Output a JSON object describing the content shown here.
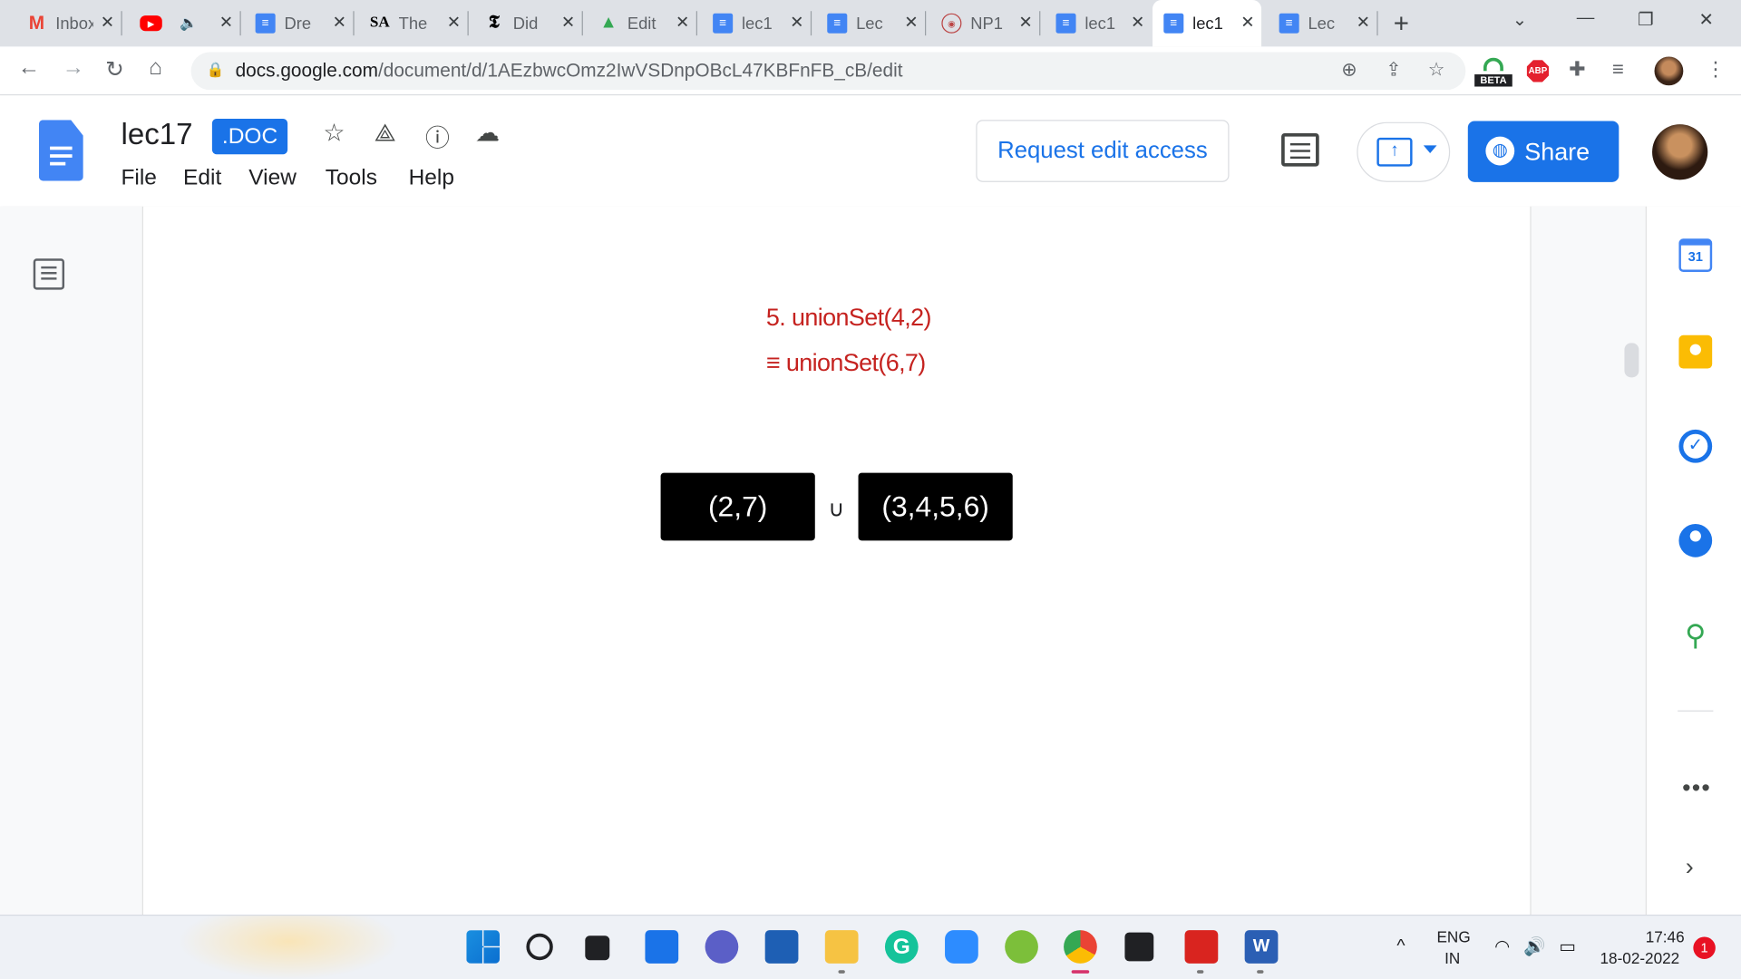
{
  "browser": {
    "tabs": [
      {
        "icon": "gmail-icon",
        "title": "Inbox"
      },
      {
        "icon": "youtube-icon",
        "title": ""
      },
      {
        "icon": "docs-icon",
        "title": "Dre"
      },
      {
        "icon": "sa-icon",
        "title": "The"
      },
      {
        "icon": "nyt-icon",
        "title": "Did"
      },
      {
        "icon": "drive-icon",
        "title": "Edit"
      },
      {
        "icon": "docs-icon",
        "title": "lec1"
      },
      {
        "icon": "docs-icon",
        "title": "Lec"
      },
      {
        "icon": "nptel-icon",
        "title": "NP1"
      },
      {
        "icon": "docs-icon",
        "title": "lec1"
      },
      {
        "icon": "docs-icon",
        "title": "lec1"
      },
      {
        "icon": "docs-icon",
        "title": "Lec"
      }
    ],
    "active_tab_index": 10,
    "url_host": "docs.google.com",
    "url_path": "/document/d/1AEzbwcOmz2IwVSDnpOBcL47KBFnFB_cB/edit",
    "beta_label": "BETA",
    "abp_label": "ABP"
  },
  "docs": {
    "title": "lec17",
    "badge": ".DOC",
    "menu": [
      "File",
      "Edit",
      "View",
      "Tools",
      "Help"
    ],
    "request_edit": "Request edit access",
    "share": "Share",
    "accent": "#1a73e8"
  },
  "content": {
    "line1": "5. unionSet(4,2)",
    "line2": "≡ unionSet(6,7)",
    "set_a": "(2,7)",
    "union_symbol": "∪",
    "set_b": "(3,4,5,6)",
    "text_color": "#c5221f"
  },
  "sidepanel": {
    "calendar_day": "31"
  },
  "taskbar": {
    "lang1": "ENG",
    "lang2": "IN",
    "time": "17:46",
    "date": "18-02-2022",
    "notifications": "1"
  }
}
